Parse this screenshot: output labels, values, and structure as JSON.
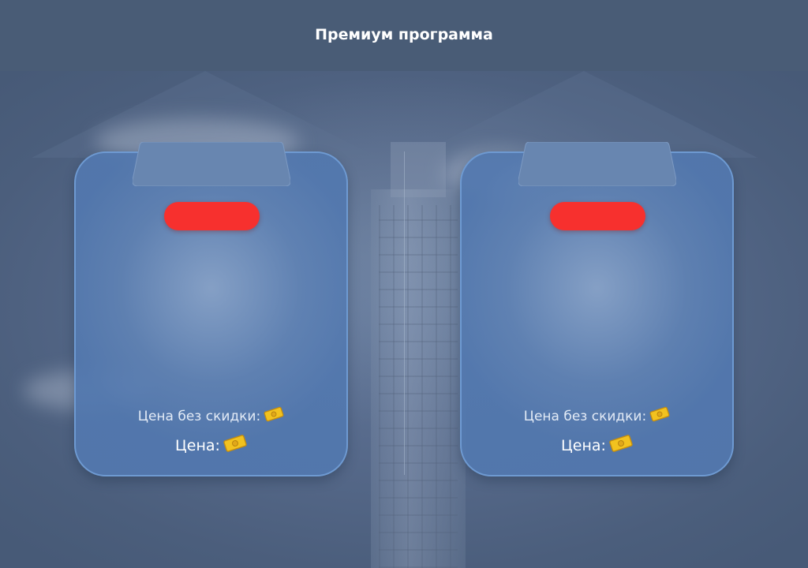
{
  "header": {
    "title": "Премиум программа"
  },
  "cards": [
    {
      "old_price_label": "Цена без скидки:",
      "price_label": "Цена:",
      "currency_icon": "money-icon"
    },
    {
      "old_price_label": "Цена без скидки:",
      "price_label": "Цена:",
      "currency_icon": "money-icon"
    }
  ],
  "colors": {
    "header_bg": "#495c76",
    "card_border": "#6e9ad2",
    "pill": "#f7302e",
    "money": "#f2c21f"
  }
}
